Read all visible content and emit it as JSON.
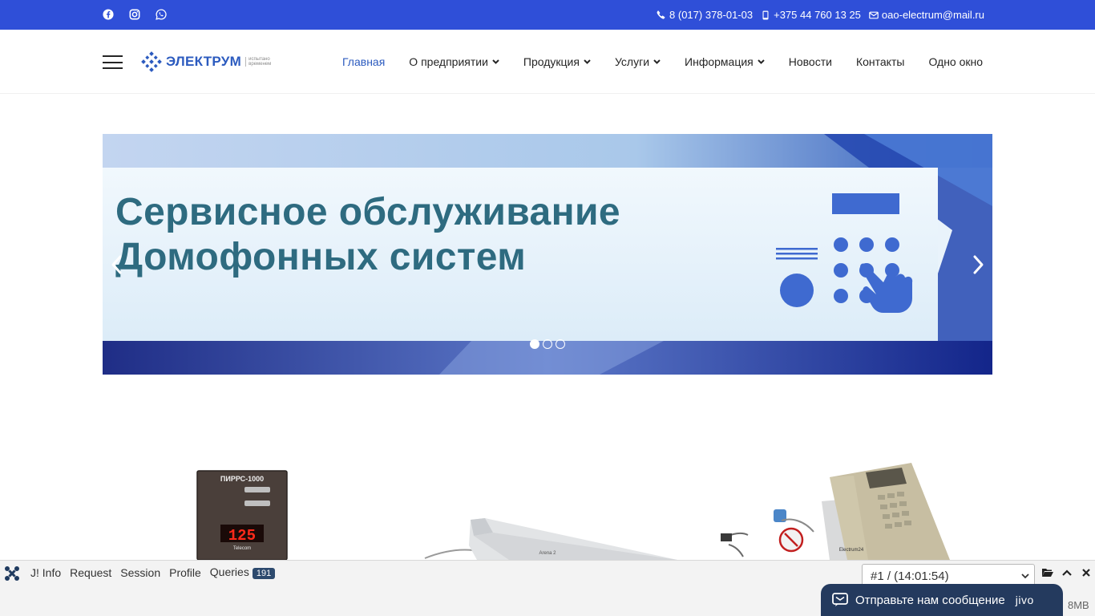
{
  "topbar": {
    "social": [
      {
        "name": "facebook-icon"
      },
      {
        "name": "instagram-icon"
      },
      {
        "name": "whatsapp-icon"
      }
    ],
    "phone": "8 (017) 378-01-03",
    "mobile": "+375 44 760 13 25",
    "email": "oao-electrum@mail.ru"
  },
  "header": {
    "logo_text": "ЭЛЕКТРУМ",
    "logo_sub": "испытано временем",
    "nav": [
      {
        "label": "Главная",
        "active": true,
        "dropdown": false
      },
      {
        "label": "О предприятии",
        "active": false,
        "dropdown": true
      },
      {
        "label": "Продукция",
        "active": false,
        "dropdown": true
      },
      {
        "label": "Услуги",
        "active": false,
        "dropdown": true
      },
      {
        "label": "Информация",
        "active": false,
        "dropdown": true
      },
      {
        "label": "Новости",
        "active": false,
        "dropdown": false
      },
      {
        "label": "Контакты",
        "active": false,
        "dropdown": false
      },
      {
        "label": "Одно окно",
        "active": false,
        "dropdown": false
      }
    ]
  },
  "slider": {
    "title_line1": "Сервисное обслуживание",
    "title_line2": "Домофонных систем",
    "slide_count": 3,
    "active_slide": 1
  },
  "products": {
    "device1_label": "ПИРРС-1000",
    "device1_display": "125",
    "device1_brand": "Telecom",
    "device2_label": "Arena 2",
    "device3_label": "Electrum24"
  },
  "debugbar": {
    "tabs": [
      "J! Info",
      "Request",
      "Session",
      "Profile",
      "Queries"
    ],
    "queries_count": "191",
    "request_select": "#1 / (14:01:54)",
    "memory": "8MB"
  },
  "chat": {
    "label": "Отправьте нам сообщение",
    "brand": "jivo"
  },
  "colors": {
    "topbar": "#2f4fd8",
    "accent": "#2c5bbf",
    "slide_text": "#2e6b80",
    "chat_bg": "#243a5e"
  }
}
